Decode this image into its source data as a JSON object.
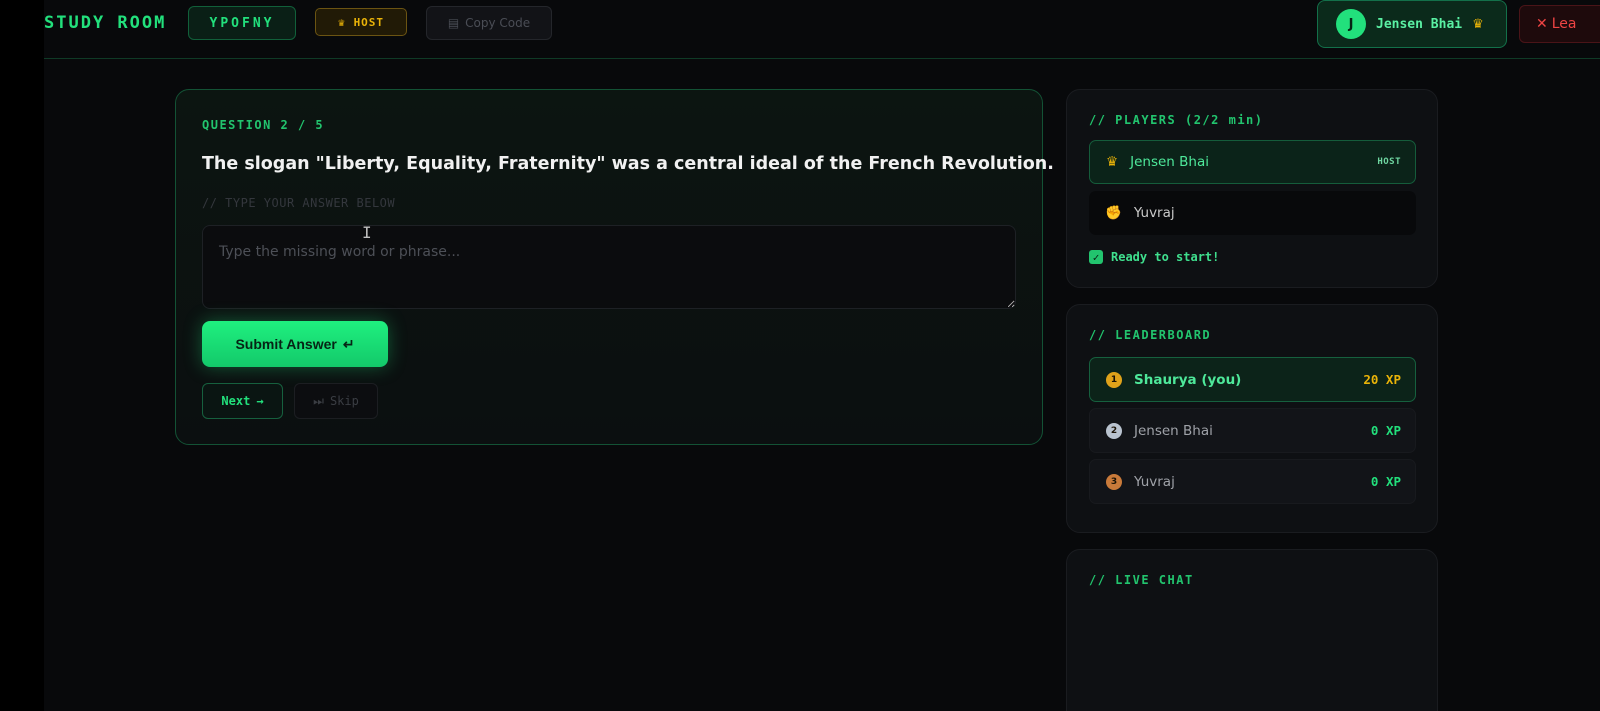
{
  "header": {
    "brand": "STUDY ROOM",
    "room_code": "YPOFNY",
    "host_badge": "HOST",
    "copy_code": "Copy Code",
    "user_initial": "J",
    "user_name": "Jensen Bhai",
    "leave_label": "Lea"
  },
  "question": {
    "counter": "QUESTION 2 / 5",
    "text": "The slogan \"Liberty, Equality, Fraternity\" was a central ideal of the French Revolution.",
    "hint": "// TYPE YOUR ANSWER BELOW",
    "answer_placeholder": "Type the missing word or phrase...",
    "answer_value": "",
    "submit_label": "Submit Answer",
    "submit_icon": "↵",
    "next_label": "Next",
    "next_icon": "→",
    "skip_label": "Skip",
    "skip_icon": "⏭"
  },
  "players": {
    "title": "// PLAYERS (2/2 min)",
    "list": [
      {
        "name": "Jensen Bhai",
        "icon": "crown-icon",
        "tag": "HOST"
      },
      {
        "name": "Yuvraj",
        "icon": "fist-icon",
        "tag": ""
      }
    ],
    "ready_text": "Ready to start!"
  },
  "leaderboard": {
    "title": "// LEADERBOARD",
    "rows": [
      {
        "name": "Shaurya (you)",
        "xp": "20 XP",
        "medal": "gold"
      },
      {
        "name": "Jensen Bhai",
        "xp": "0 XP",
        "medal": "silver"
      },
      {
        "name": "Yuvraj",
        "xp": "0 XP",
        "medal": "bronze"
      }
    ]
  },
  "chat": {
    "title": "// LIVE CHAT"
  },
  "colors": {
    "accent": "#22e07c",
    "gold": "#eab308",
    "danger": "#ef4444",
    "background": "#08090b"
  }
}
